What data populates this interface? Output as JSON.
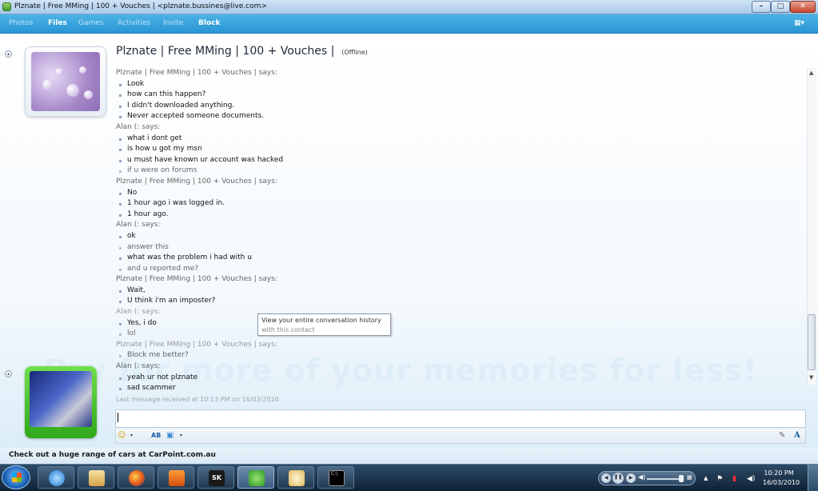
{
  "window": {
    "title": "Plznate |  Free MMing | 100 + Vouches | <plznate.bussines@live.com>",
    "controls": {
      "minimize": "–",
      "maximize": "□",
      "close": "✕"
    }
  },
  "menu": {
    "items": [
      "Photos",
      "Files",
      "Games",
      "Activities",
      "Invite",
      "Block"
    ],
    "right_icon": "layout-menu-icon"
  },
  "contact": {
    "name": "Plznate |  Free MMing | 100 + Vouches |",
    "status": "(Offline)"
  },
  "conversation": [
    {
      "type": "sender",
      "text": "Plznate |  Free MMing | 100 + Vouches | says:"
    },
    {
      "type": "msg",
      "text": "Look"
    },
    {
      "type": "msg",
      "text": "how can this happen?"
    },
    {
      "type": "msg",
      "text": "I didn't downloaded anything."
    },
    {
      "type": "msg",
      "text": "Never accepted someone documents."
    },
    {
      "type": "sender",
      "text": "Alan (: says:"
    },
    {
      "type": "msg",
      "text": "what i dont get"
    },
    {
      "type": "msg",
      "text": "is how u got my msn"
    },
    {
      "type": "msg",
      "text": "u must have known ur account was hacked"
    },
    {
      "type": "msg",
      "text": "if u were on forums"
    },
    {
      "type": "sender",
      "text": "Plznate |  Free MMing | 100 + Vouches | says:"
    },
    {
      "type": "msg",
      "text": "No"
    },
    {
      "type": "msg",
      "text": "1 hour ago i was logged in."
    },
    {
      "type": "msg",
      "text": "1 hour ago."
    },
    {
      "type": "sender",
      "text": "Alan (: says:"
    },
    {
      "type": "msg",
      "text": "ok"
    },
    {
      "type": "msg",
      "text": "answer this"
    },
    {
      "type": "msg",
      "text": "what was the problem i had with u"
    },
    {
      "type": "msg",
      "text": "and u reported me?"
    },
    {
      "type": "sender",
      "text": "Plznate |  Free MMing | 100 + Vouches | says:"
    },
    {
      "type": "msg",
      "text": "Wait,"
    },
    {
      "type": "msg",
      "text": "U think i'm an imposter?"
    },
    {
      "type": "sender",
      "text": "Alan (: says:"
    },
    {
      "type": "msg",
      "text": "Yes, i do"
    },
    {
      "type": "msg",
      "text": "lol"
    },
    {
      "type": "sender",
      "text": "Plznate |  Free MMing | 100 + Vouches | says:"
    },
    {
      "type": "msg",
      "text": "Block me better?"
    },
    {
      "type": "sender",
      "text": "Alan (: says:"
    },
    {
      "type": "msg",
      "text": "yeah ur not plznate"
    },
    {
      "type": "msg",
      "text": "sad scammer"
    },
    {
      "type": "note",
      "text": "Last message received at 10:13 PM on 16/03/2010."
    }
  ],
  "tooltip": {
    "line1": "View your entire conversation history",
    "line2": "with this contact"
  },
  "promo_watermark": "Pay for more of your memories for less!",
  "input": {
    "value": ""
  },
  "ad": {
    "text": "Check out a huge range of cars at CarPoint.com.au"
  },
  "toolbar": {
    "font_label": "AB",
    "font_button": "A"
  },
  "taskbar": {
    "apps": [
      "ie-icon",
      "explorer-icon",
      "firefox-icon",
      "media-player-icon",
      "sk-icon",
      "msn-icon",
      "paint-icon",
      "cmd-icon"
    ],
    "sk_label": "SK",
    "cmd_label": "C:\\"
  },
  "clock": {
    "time": "10:20 PM",
    "date": "16/03/2010"
  },
  "colors": {
    "menu_bar": "#2895d4",
    "avatar_green": "#2fa81a",
    "taskbar": "#0f2236"
  }
}
